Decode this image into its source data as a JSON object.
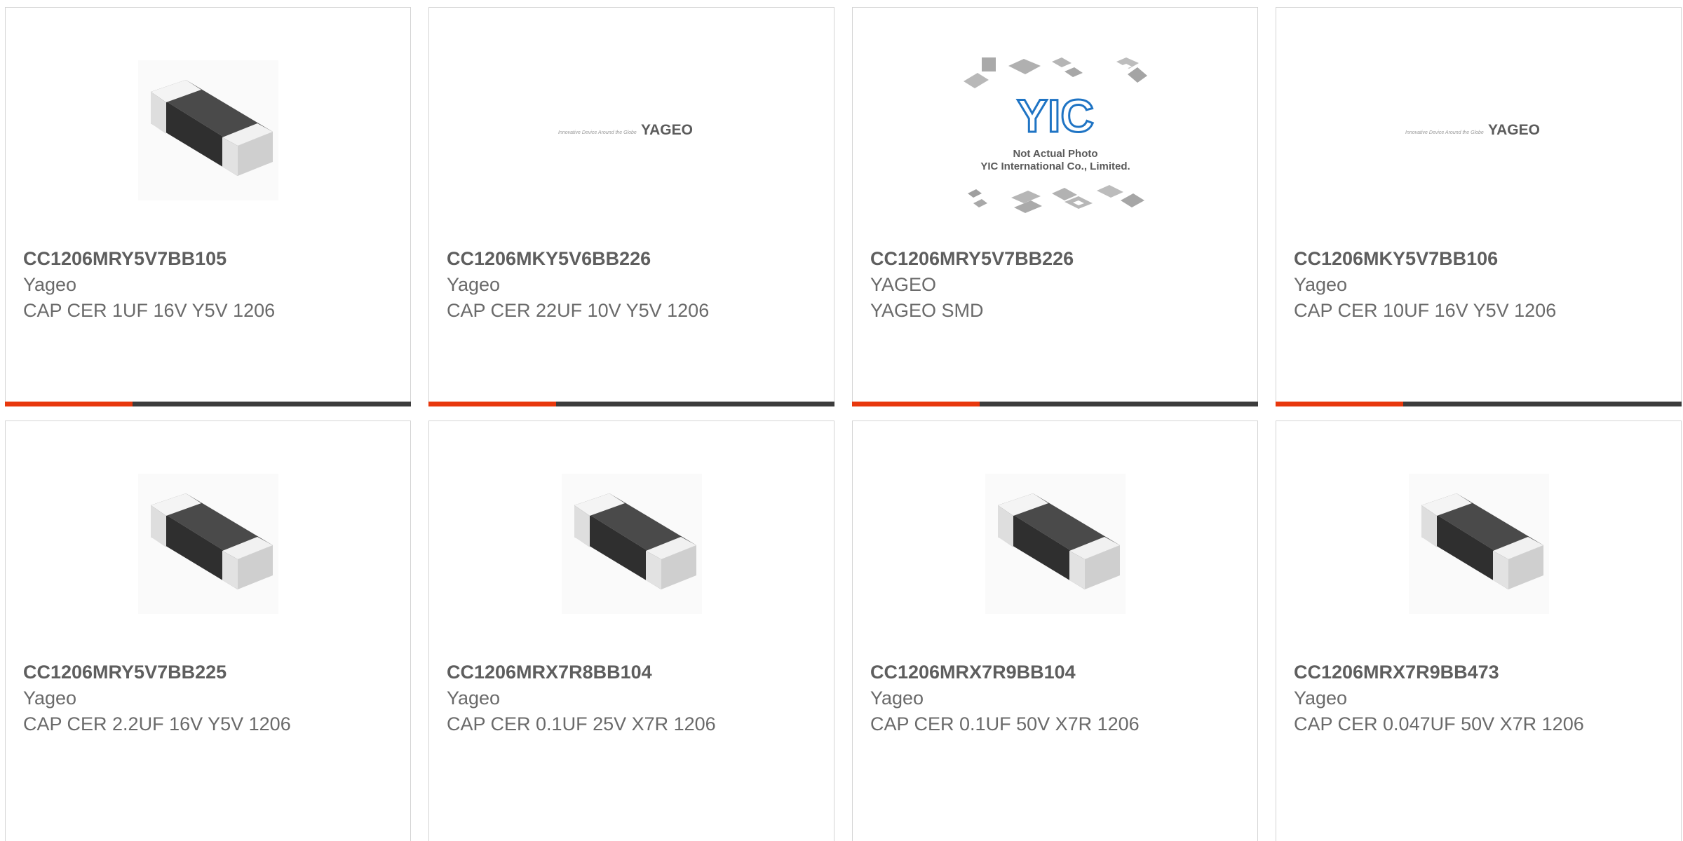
{
  "colors": {
    "accent": "#e8380d",
    "bar_dark": "#3c3c3c",
    "border": "#d4d4d4"
  },
  "products": [
    {
      "part_number": "CC1206MRY5V7BB105",
      "manufacturer": "Yageo",
      "description": "CAP CER 1UF 16V Y5V 1206",
      "image": "chip-capacitor"
    },
    {
      "part_number": "CC1206MKY5V6BB226",
      "manufacturer": "Yageo",
      "description": "CAP CER 22UF 10V Y5V 1206",
      "image": "yageo-logo"
    },
    {
      "part_number": "CC1206MRY5V7BB226",
      "manufacturer": "YAGEO",
      "description": "YAGEO SMD",
      "image": "yic-placeholder"
    },
    {
      "part_number": "CC1206MKY5V7BB106",
      "manufacturer": "Yageo",
      "description": "CAP CER 10UF 16V Y5V 1206",
      "image": "yageo-logo"
    },
    {
      "part_number": "CC1206MRY5V7BB225",
      "manufacturer": "Yageo",
      "description": "CAP CER 2.2UF 16V Y5V 1206",
      "image": "chip-capacitor"
    },
    {
      "part_number": "CC1206MRX7R8BB104",
      "manufacturer": "Yageo",
      "description": "CAP CER 0.1UF 25V X7R 1206",
      "image": "chip-capacitor"
    },
    {
      "part_number": "CC1206MRX7R9BB104",
      "manufacturer": "Yageo",
      "description": "CAP CER 0.1UF 50V X7R 1206",
      "image": "chip-capacitor"
    },
    {
      "part_number": "CC1206MRX7R9BB473",
      "manufacturer": "Yageo",
      "description": "CAP CER 0.047UF 50V X7R 1206",
      "image": "chip-capacitor"
    }
  ],
  "logos": {
    "yageo_wordmark": "YAGEO",
    "yageo_tagline": "Innovative Device Around the Globe",
    "yic_mark": "YIC",
    "yic_line1": "Not Actual Photo",
    "yic_line2": "YIC International Co., Limited."
  }
}
